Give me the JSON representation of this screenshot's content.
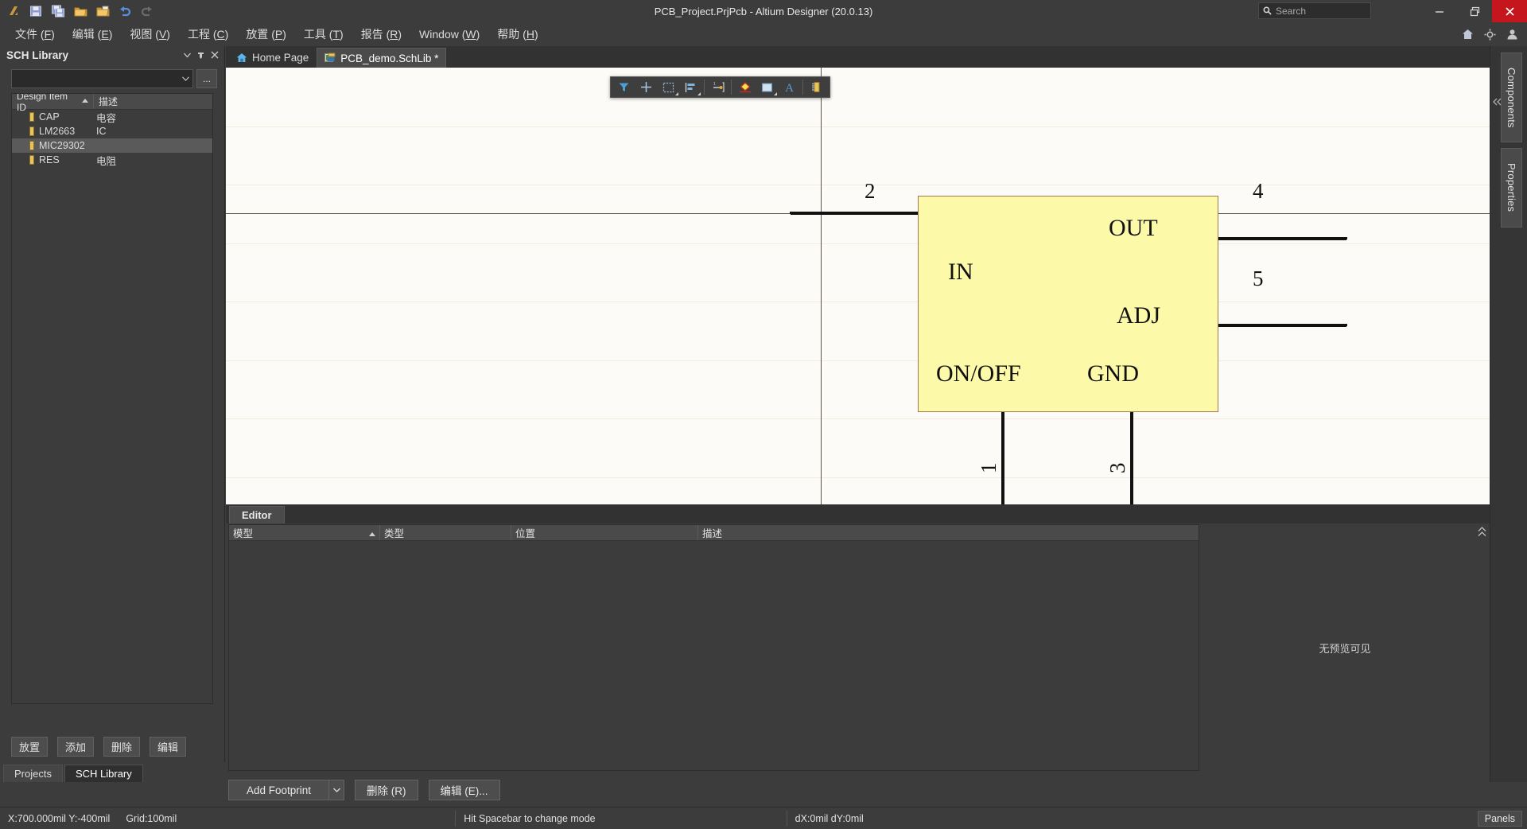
{
  "window": {
    "title": "PCB_Project.PrjPcb - Altium Designer (20.0.13)",
    "minimize_label": "—",
    "restore_label": "❐",
    "close_label": "✕"
  },
  "search": {
    "placeholder": "Search",
    "value": "",
    "icon": "search-icon"
  },
  "quick_access": [
    {
      "name": "altium-logo-icon",
      "label": ""
    },
    {
      "name": "save-icon",
      "label": ""
    },
    {
      "name": "save-all-icon",
      "label": ""
    },
    {
      "name": "open-folder-icon",
      "label": ""
    },
    {
      "name": "open-document-icon",
      "label": ""
    },
    {
      "name": "undo-icon",
      "label": ""
    },
    {
      "name": "redo-icon",
      "label": ""
    }
  ],
  "menubar": {
    "items": [
      {
        "text": "文件",
        "accel": "F"
      },
      {
        "text": "编辑",
        "accel": "E"
      },
      {
        "text": "视图",
        "accel": "V"
      },
      {
        "text": "工程",
        "accel": "C"
      },
      {
        "text": "放置",
        "accel": "P"
      },
      {
        "text": "工具",
        "accel": "T"
      },
      {
        "text": "报告",
        "accel": "R"
      },
      {
        "text": "Window",
        "accel": "W"
      },
      {
        "text": "帮助",
        "accel": "H"
      }
    ],
    "right_icons": [
      "home-icon",
      "gear-icon",
      "account-icon"
    ]
  },
  "sch_library_panel": {
    "title": "SCH Library",
    "header_icons": [
      "chevron-down-icon",
      "pin-icon",
      "close-icon"
    ],
    "filter_combo": {
      "value": "",
      "placeholder": ""
    },
    "browse_button_label": "...",
    "grid": {
      "columns": [
        "Design Item ID",
        "描述"
      ],
      "sort_column": "Design Item ID",
      "sort_direction": "asc",
      "rows": [
        {
          "id": "CAP",
          "desc": "电容",
          "selected": false
        },
        {
          "id": "LM2663",
          "desc": "IC",
          "selected": false
        },
        {
          "id": "MIC29302",
          "desc": "",
          "selected": true
        },
        {
          "id": "RES",
          "desc": "电阻",
          "selected": false
        }
      ]
    },
    "buttons": [
      {
        "label": "放置",
        "name": "place-button"
      },
      {
        "label": "添加",
        "name": "add-button"
      },
      {
        "label": "删除",
        "name": "delete-button"
      },
      {
        "label": "编辑",
        "name": "edit-button"
      }
    ],
    "bottom_tabs": [
      {
        "label": "Projects",
        "active": false
      },
      {
        "label": "SCH Library",
        "active": true
      }
    ]
  },
  "document_tabs": [
    {
      "label": "Home Page",
      "icon": "home-icon",
      "active": false
    },
    {
      "label": "PCB_demo.SchLib *",
      "icon": "schlib-document-icon",
      "active": true
    }
  ],
  "canvas_toolbar": {
    "buttons": [
      {
        "name": "filter-icon",
        "has_dropdown": false
      },
      {
        "name": "place-crosshair-icon",
        "has_dropdown": false
      },
      {
        "name": "select-rectangle-icon",
        "has_dropdown": true
      },
      {
        "name": "align-icon",
        "has_dropdown": true
      },
      {
        "name": "place-pin-icon",
        "has_dropdown": false
      },
      {
        "name": "place-graphic-icon",
        "has_dropdown": false
      },
      {
        "name": "place-rectangle-icon",
        "has_dropdown": true
      },
      {
        "name": "place-text-icon",
        "has_dropdown": false
      },
      {
        "name": "place-component-icon",
        "has_dropdown": false
      }
    ]
  },
  "schematic": {
    "component_name": "MIC29302",
    "body_color": "#fcf9a8",
    "border_color": "#9e7a53",
    "background_color": "#fdfbf7",
    "grid_color": "#f2ecdf",
    "pins": [
      {
        "number": "1",
        "name": "ON/OFF",
        "side": "bottom"
      },
      {
        "number": "2",
        "name": "IN",
        "side": "left"
      },
      {
        "number": "3",
        "name": "GND",
        "side": "bottom"
      },
      {
        "number": "4",
        "name": "OUT",
        "side": "right"
      },
      {
        "number": "5",
        "name": "ADJ",
        "side": "right"
      }
    ]
  },
  "editor_strip": {
    "tab_label": "Editor"
  },
  "model_table": {
    "columns": [
      "模型",
      "类型",
      "位置",
      "描述"
    ],
    "sort_column": "模型",
    "sort_direction": "asc",
    "rows": []
  },
  "preview": {
    "text": "无预览可见",
    "collapse_icon": "chevron-up-icon"
  },
  "footprint_buttons": {
    "add_footprint_label": "Add Footprint",
    "add_footprint_dropdown": "▾",
    "delete_label": "删除 (R)",
    "edit_label": "编辑 (E)..."
  },
  "right_sidebar": {
    "collapse_icon": "chevrons-left-icon",
    "tabs": [
      {
        "label": "Components"
      },
      {
        "label": "Properties"
      }
    ]
  },
  "statusbar": {
    "coordinates": "X:700.000mil Y:-400mil",
    "grid": "Grid:100mil",
    "hint": "Hit Spacebar to change mode",
    "delta": "dX:0mil dY:0mil",
    "panels_label": "Panels"
  }
}
